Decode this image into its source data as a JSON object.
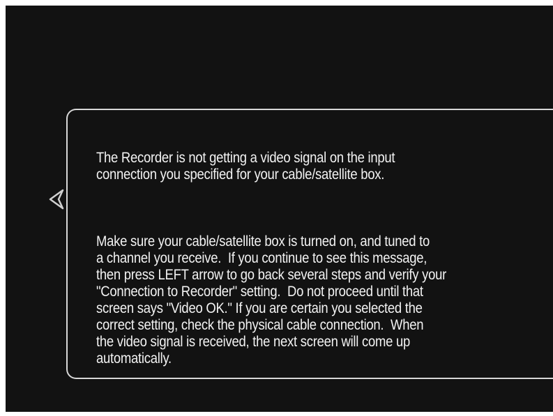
{
  "navigation": {
    "back_icon": "left-triangle-arrow-icon"
  },
  "message": {
    "paragraph_1": "The Recorder is not getting a video signal on the input\nconnection you specified for your cable/satellite box.",
    "paragraph_2": "Make sure your cable/satellite box is turned on, and tuned to\na channel you receive.  If you continue to see this message,\nthen press LEFT arrow to go back several steps and verify your\n\"Connection to Recorder\" setting.  Do not proceed until that\nscreen says \"Video OK.\" If you are certain you selected the\ncorrect setting, check the physical cable connection.  When\nthe video signal is received, the next screen will come up\nautomatically."
  },
  "colors": {
    "screen_background": "#121212",
    "text": "#f2f2f2",
    "border": "#d8d8d8"
  }
}
